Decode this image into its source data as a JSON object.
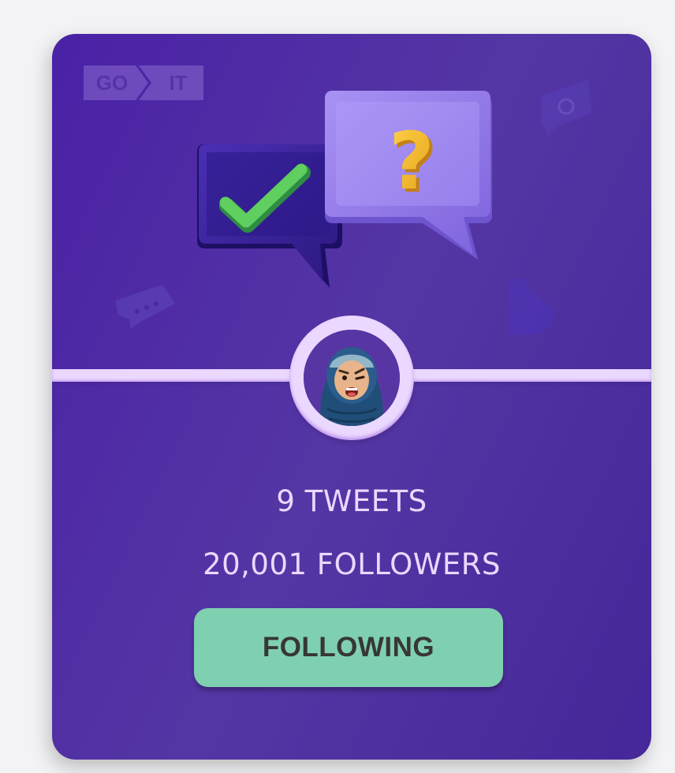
{
  "brand": {
    "logo_left": "GO",
    "logo_right": "IT"
  },
  "user": {
    "tweets_label": "9 TWEETS",
    "followers_label": "20,001 FOLLOWERS"
  },
  "actions": {
    "follow_button_label": "FOLLOWING"
  },
  "colors": {
    "card_background": "#5736a3",
    "accent_line": "#ebd8ff",
    "button_active": "#7fd0b0",
    "text_light": "#ebd8ff",
    "text_dark": "#373737"
  },
  "icons": [
    "go-it-logo-icon",
    "checkmark-bubble-icon",
    "question-bubble-icon",
    "avatar-icon"
  ]
}
